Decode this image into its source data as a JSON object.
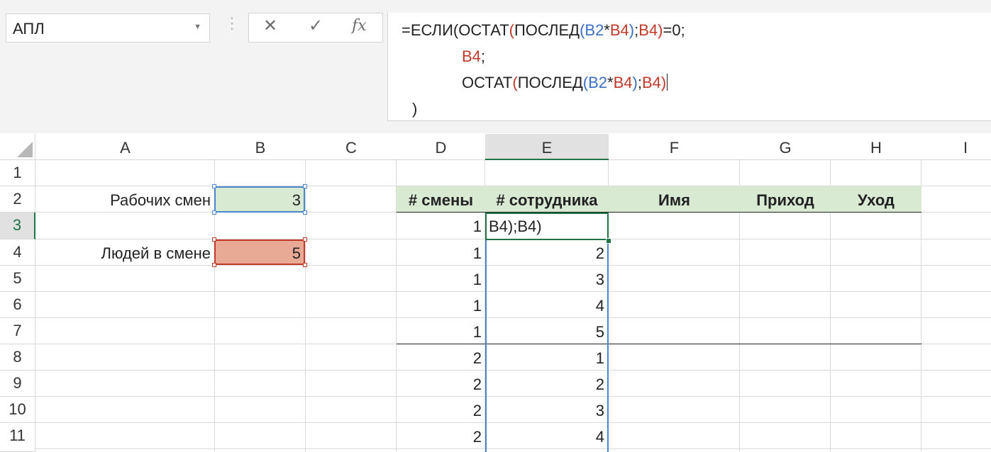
{
  "namebox": {
    "value": "АПЛ",
    "arrow": "▼"
  },
  "formula_bar": {
    "cancel_icon": "✕",
    "enter_icon": "✓",
    "fx_icon": "fx",
    "line1": {
      "p1": "=ЕСЛИ(ОСТАТ",
      "p2": "(",
      "p3": "ПОСЛЕД",
      "p4": "(",
      "p5": "B2",
      "p6": "*",
      "p7": "B4",
      "p8": ")",
      "p9": ";",
      "p10": "B4",
      "p11": ")",
      "p12": "=0;"
    },
    "line2": {
      "p1": "B4",
      "p2": ";"
    },
    "line3": {
      "p1": "ОСТАТ",
      "p2": "(",
      "p3": "ПОСЛЕД",
      "p4": "(",
      "p5": "B2",
      "p6": "*",
      "p7": "B4",
      "p8": ")",
      "p9": ";",
      "p10": "B4",
      "p11": ")"
    },
    "line4": ")"
  },
  "columns": [
    "A",
    "B",
    "C",
    "D",
    "E",
    "F",
    "G",
    "H",
    "I"
  ],
  "rows": [
    "1",
    "2",
    "3",
    "4",
    "5",
    "6",
    "7",
    "8",
    "9",
    "10",
    "11"
  ],
  "selected_column": "E",
  "selected_row": "3",
  "cells": {
    "A2": "Рабочих смен",
    "B2": "3",
    "A4": "Людей в смене",
    "B4": "5",
    "E3_editing": "B4);B4)"
  },
  "table": {
    "headers": [
      "# смены",
      "# сотрудника",
      "Имя",
      "Приход",
      "Уход"
    ],
    "rows": [
      {
        "shift": "1",
        "employee": ""
      },
      {
        "shift": "1",
        "employee": "2"
      },
      {
        "shift": "1",
        "employee": "3"
      },
      {
        "shift": "1",
        "employee": "4"
      },
      {
        "shift": "1",
        "employee": "5"
      },
      {
        "shift": "2",
        "employee": "1"
      },
      {
        "shift": "2",
        "employee": "2"
      },
      {
        "shift": "2",
        "employee": "3"
      },
      {
        "shift": "2",
        "employee": "4"
      }
    ]
  },
  "colors": {
    "header_fill": "#d9ead3",
    "b2_border": "#4a86c8",
    "b4_fill": "#e8a995",
    "b4_border": "#c0392b",
    "active_border": "#217346"
  }
}
